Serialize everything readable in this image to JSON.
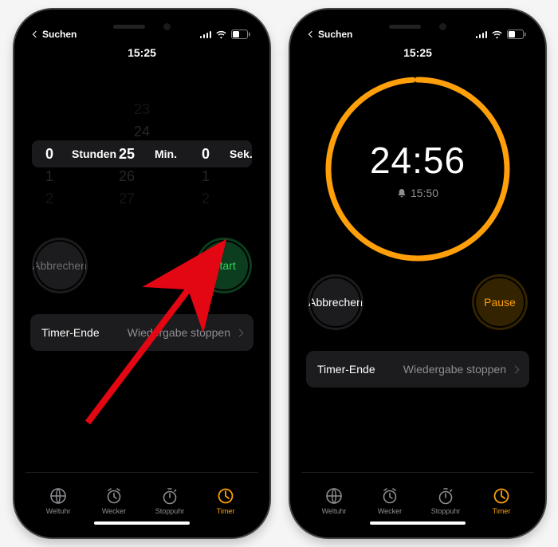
{
  "status": {
    "time": "15:25",
    "back": "Suchen"
  },
  "picker": {
    "hours_label": "Stunden",
    "mins_label": "Min.",
    "secs_label": "Sek.",
    "hours_col": {
      "above2": "",
      "above1": "",
      "selected": "0",
      "below1": "1",
      "below2": "2"
    },
    "mins_col": {
      "above2": "23",
      "above1": "24",
      "selected": "25",
      "below1": "26",
      "below2": "27"
    },
    "secs_col": {
      "above2": "",
      "above1": "",
      "selected": "0",
      "below1": "1",
      "below2": "2"
    }
  },
  "running": {
    "remaining": "24:56",
    "end_at": "15:50"
  },
  "buttons": {
    "cancel": "Abbrechen",
    "start": "Start",
    "pause": "Pause"
  },
  "option": {
    "label": "Timer-Ende",
    "value": "Wiedergabe stoppen"
  },
  "tabs": {
    "worldclock": "Weltuhr",
    "alarm": "Wecker",
    "stopwatch": "Stoppuhr",
    "timer": "Timer"
  }
}
